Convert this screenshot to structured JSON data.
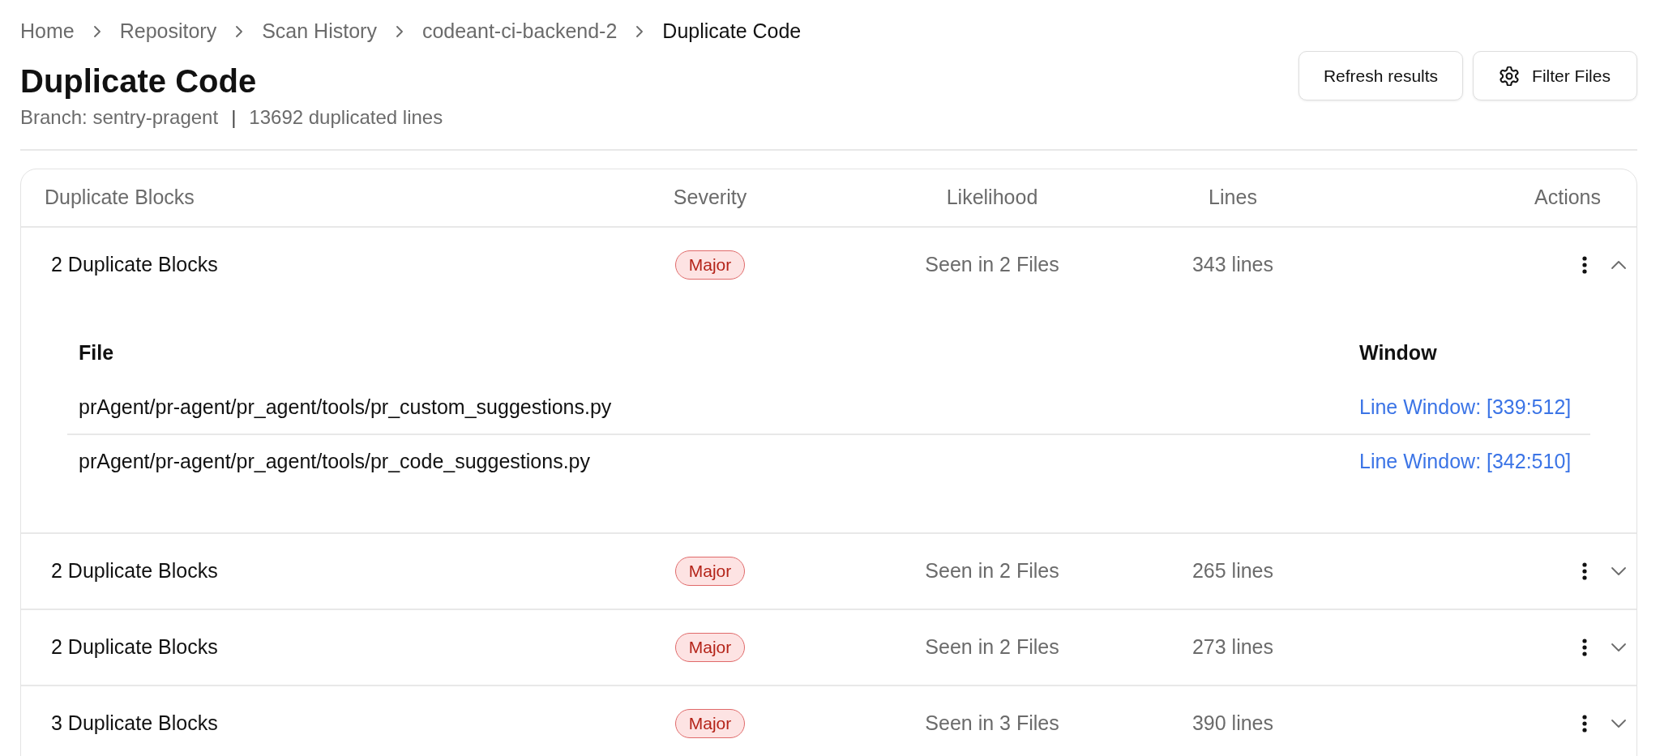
{
  "breadcrumbs": [
    {
      "label": "Home",
      "current": false
    },
    {
      "label": "Repository",
      "current": false
    },
    {
      "label": "Scan History",
      "current": false
    },
    {
      "label": "codeant-ci-backend-2",
      "current": false
    },
    {
      "label": "Duplicate Code",
      "current": true
    }
  ],
  "header": {
    "title": "Duplicate Code",
    "branch": "Branch: sentry-pragent",
    "separator": "|",
    "summary": "13692 duplicated lines"
  },
  "buttons": [
    {
      "label": "Refresh results",
      "kind": "text"
    },
    {
      "label": "Filter Files",
      "kind": "gear"
    }
  ],
  "table": {
    "columns": [
      "Duplicate Blocks",
      "Severity",
      "Likelihood",
      "Lines",
      "Actions"
    ],
    "rows": [
      {
        "blocks": "2 Duplicate Blocks",
        "severity": "Major",
        "likelihood": "Seen in 2 Files",
        "lines": "343 lines",
        "expanded": true,
        "files": {
          "columns": [
            "File",
            "Window"
          ],
          "rows": [
            {
              "path": "prAgent/pr-agent/pr_agent/tools/pr_custom_suggestions.py",
              "window": "Line Window: [339:512]"
            },
            {
              "path": "prAgent/pr-agent/pr_agent/tools/pr_code_suggestions.py",
              "window": "Line Window: [342:510]"
            }
          ]
        }
      },
      {
        "blocks": "2 Duplicate Blocks",
        "severity": "Major",
        "likelihood": "Seen in 2 Files",
        "lines": "265 lines",
        "expanded": false
      },
      {
        "blocks": "2 Duplicate Blocks",
        "severity": "Major",
        "likelihood": "Seen in 2 Files",
        "lines": "273 lines",
        "expanded": false
      },
      {
        "blocks": "3 Duplicate Blocks",
        "severity": "Major",
        "likelihood": "Seen in 3 Files",
        "lines": "390 lines",
        "expanded": false
      }
    ]
  }
}
